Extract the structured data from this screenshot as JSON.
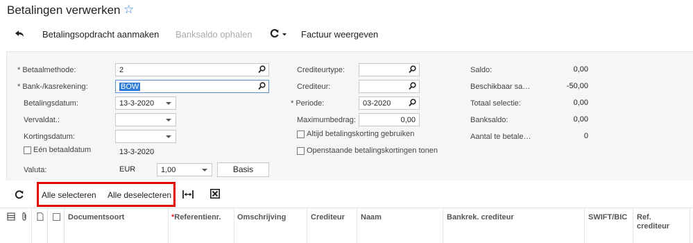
{
  "page": {
    "title": "Betalingen verwerken",
    "favorite_icon": "star-outline-icon"
  },
  "toolbar": {
    "undo_icon": "undo-icon",
    "create_order_label": "Betalingsopdracht aanmaken",
    "fetch_balance_label": "Banksaldo ophalen",
    "actions_icon": "refresh-dropdown-icon",
    "show_invoice_label": "Factuur weergeven"
  },
  "form": {
    "betaalmethode": {
      "label": "Betaalmethode:",
      "value": "2",
      "required": "*"
    },
    "bankrekening": {
      "label": "Bank-/kasrekening:",
      "value": "BOW",
      "required": "*"
    },
    "betalingsdatum": {
      "label": "Betalingsdatum:",
      "value": "13-3-2020"
    },
    "vervaldat": {
      "label": "Vervaldat.:",
      "value": ""
    },
    "kortingsdatum": {
      "label": "Kortingsdatum:",
      "value": ""
    },
    "een_betaaldatum": {
      "label": "Eén betaaldatum",
      "value": "13-3-2020"
    },
    "valuta": {
      "label": "Valuta:",
      "currency": "EUR",
      "rate": "1,00",
      "basis_label": "Basis"
    },
    "crediteurtype": {
      "label": "Crediteurtype:",
      "value": ""
    },
    "crediteur": {
      "label": "Crediteur:",
      "value": ""
    },
    "periode": {
      "label": "Periode:",
      "value": "03-2020",
      "required": "*"
    },
    "maximumbedrag": {
      "label": "Maximumbedrag:",
      "value": "0,00"
    },
    "altijd_korting": {
      "label": "Altijd betalingskorting gebruiken"
    },
    "openstaande_korting": {
      "label": "Openstaande betalingskortingen tonen"
    }
  },
  "summary": {
    "saldo": {
      "label": "Saldo:",
      "value": "0,00"
    },
    "beschikbaar": {
      "label": "Beschikbaar sa…",
      "value": "-50,00"
    },
    "totaal_selectie": {
      "label": "Totaal selectie:",
      "value": "0,00"
    },
    "banksaldo": {
      "label": "Banksaldo:",
      "value": "0,00"
    },
    "aantal": {
      "label": "Aantal te betale…",
      "value": "0"
    }
  },
  "grid_toolbar": {
    "refresh_icon": "refresh-icon",
    "select_all_label": "Alle selecteren",
    "deselect_all_label": "Alle deselecteren",
    "fit_columns_icon": "fit-columns-icon",
    "export_excel_icon": "excel-export-icon"
  },
  "grid": {
    "columns": [
      "Documentsoort",
      "Referentienr.",
      "Omschrijving",
      "Crediteur",
      "Naam",
      "Bankrek. crediteur",
      "SWIFT/BIC",
      "Ref. crediteur"
    ],
    "required_marker": "*"
  }
}
